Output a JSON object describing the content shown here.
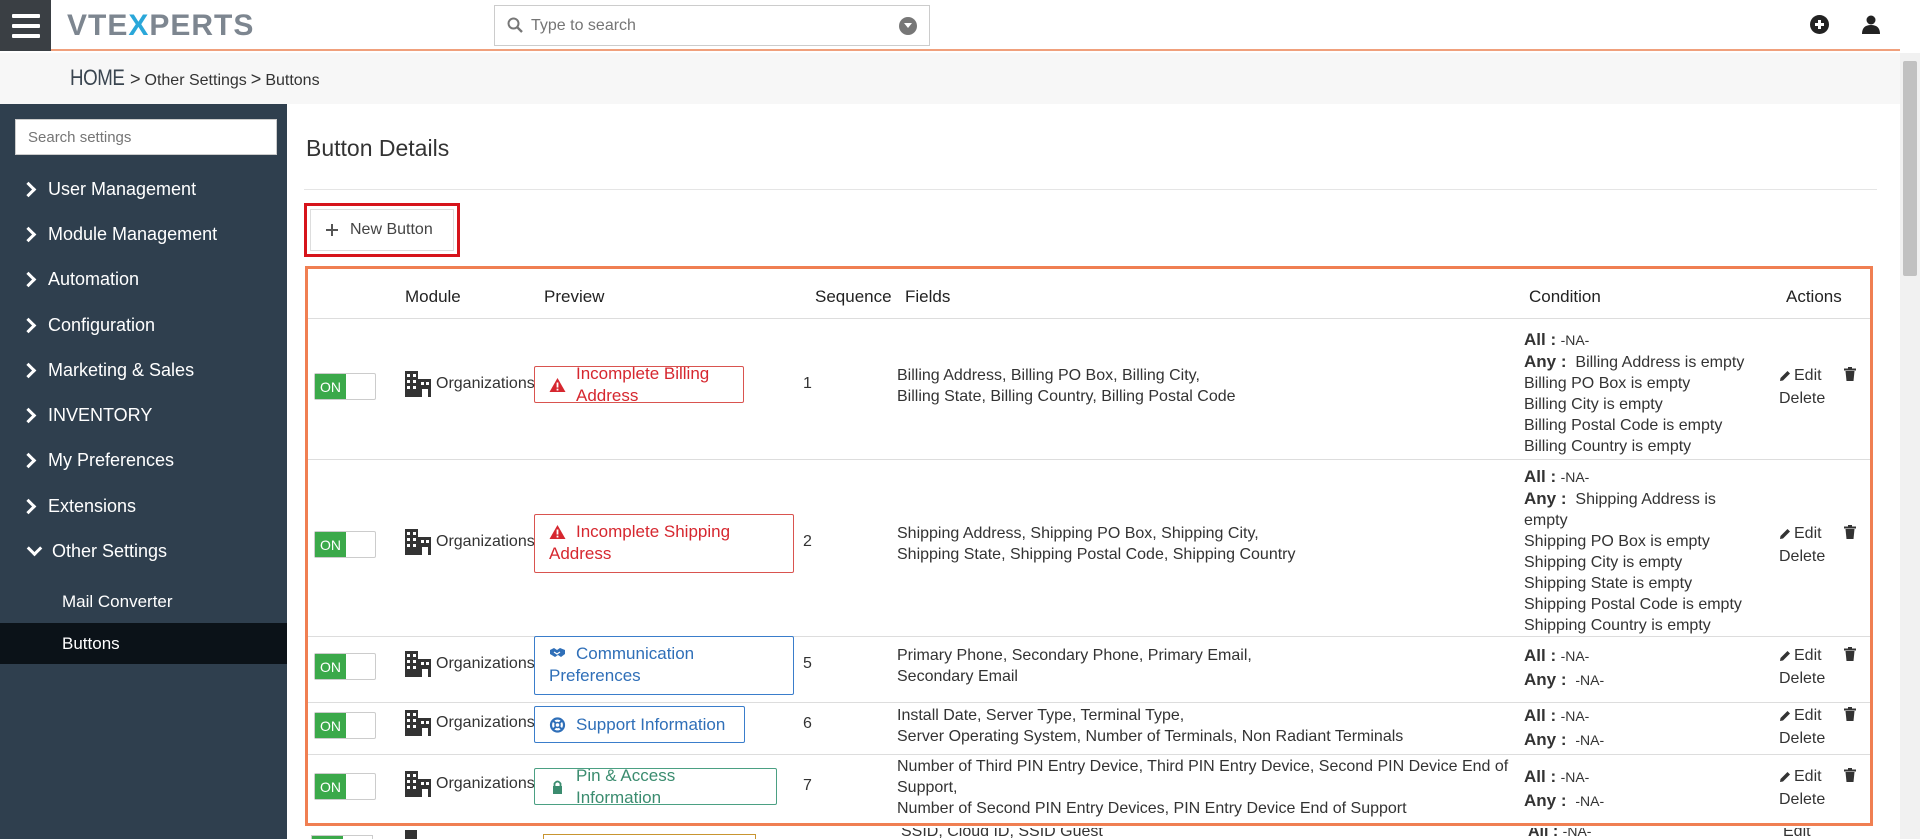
{
  "app": {
    "logo_left": "VTE",
    "logo_x": "X",
    "logo_right": "PERTS"
  },
  "search": {
    "placeholder": "Type to search"
  },
  "breadcrumb": {
    "home": "HOME",
    "sep1": ">",
    "item1": "Other Settings",
    "sep2": ">",
    "item2": "Buttons"
  },
  "sidebar": {
    "search_placeholder": "Search settings",
    "items": [
      {
        "label": "User Management"
      },
      {
        "label": "Module Management"
      },
      {
        "label": "Automation"
      },
      {
        "label": "Configuration"
      },
      {
        "label": "Marketing & Sales"
      },
      {
        "label": "INVENTORY"
      },
      {
        "label": "My Preferences"
      },
      {
        "label": "Extensions"
      },
      {
        "label": "Other Settings"
      }
    ],
    "subitems": [
      {
        "label": "Mail Converter"
      },
      {
        "label": "Buttons"
      }
    ]
  },
  "main": {
    "title": "Button Details",
    "new_button": "New Button",
    "headers": {
      "module": "Module",
      "preview": "Preview",
      "sequence": "Sequence",
      "fields": "Fields",
      "condition": "Condition",
      "actions": "Actions"
    },
    "rows": [
      {
        "toggle": "ON",
        "module": "Organizations",
        "preview": "Incomplete Billing Address",
        "preview_icon": "warning-icon",
        "preview_color": "#d6272f",
        "sequence": "1",
        "fields_1": "Billing Address, Billing PO Box, Billing City,",
        "fields_2": "Billing State, Billing Country, Billing Postal Code",
        "all_label": "All :",
        "all_value": "-NA-",
        "any_label": "Any :",
        "any_value": "Billing Address is empty",
        "cond_lines": [
          "Billing PO Box is empty",
          "Billing City is empty",
          "Billing Postal Code is empty",
          "Billing Country is empty"
        ],
        "edit": "Edit",
        "delete": "Delete"
      },
      {
        "toggle": "ON",
        "module": "Organizations",
        "preview_1": "Incomplete Shipping",
        "preview_2": "Address",
        "preview_icon": "warning-icon",
        "preview_color": "#d6272f",
        "sequence": "2",
        "fields_1": "Shipping Address, Shipping PO Box, Shipping City,",
        "fields_2": "Shipping State, Shipping Postal Code, Shipping Country",
        "all_label": "All :",
        "all_value": "-NA-",
        "any_label": "Any :",
        "any_value": "Shipping Address is",
        "any_value_2": "empty",
        "cond_lines": [
          "Shipping PO Box is empty",
          "Shipping City is empty",
          "Shipping State is empty",
          "Shipping Postal Code is empty",
          "Shipping Country is empty"
        ],
        "edit": "Edit",
        "delete": "Delete"
      },
      {
        "toggle": "ON",
        "module": "Organizations",
        "preview_1": "Communication",
        "preview_2": "Preferences",
        "preview_icon": "handshake-icon",
        "preview_color": "#2f6fb8",
        "sequence": "5",
        "fields_1": "Primary Phone, Secondary Phone, Primary Email,",
        "fields_2": "Secondary Email",
        "all_label": "All :",
        "all_value": "-NA-",
        "any_label": "Any :",
        "any_value": "-NA-",
        "edit": "Edit",
        "delete": "Delete"
      },
      {
        "toggle": "ON",
        "module": "Organizations",
        "preview": "Support Information",
        "preview_icon": "lifebuoy-icon",
        "preview_color": "#2f6fb8",
        "sequence": "6",
        "fields_1": "Install Date, Server Type, Terminal Type,",
        "fields_2": "Server Operating System, Number of Terminals, Non Radiant Terminals",
        "all_label": "All :",
        "all_value": "-NA-",
        "any_label": "Any :",
        "any_value": "-NA-",
        "edit": "Edit",
        "delete": "Delete"
      },
      {
        "toggle": "ON",
        "module": "Organizations",
        "preview": "Pin & Access Information",
        "preview_icon": "lock-icon",
        "preview_color": "#3b8c6f",
        "sequence": "7",
        "fields_1": "Number of Third PIN Entry Device, Third PIN Entry Device, Second PIN Device End of",
        "fields_2": "Support,",
        "fields_3": "Number of Second PIN Entry Devices, PIN Entry Device End of Support",
        "all_label": "All :",
        "all_value": "-NA-",
        "any_label": "Any :",
        "any_value": "-NA-",
        "edit": "Edit",
        "delete": "Delete"
      },
      {
        "fields_1": "SSID, Cloud ID, SSID Guest",
        "all_label": "All :",
        "all_value": "-NA-",
        "edit": "Edit"
      }
    ]
  },
  "colors": {
    "sidebar_bg": "#2f3f4e",
    "accent_orange": "#f07f52",
    "highlight_red": "#d6141b",
    "on_green": "#3ba94a"
  }
}
